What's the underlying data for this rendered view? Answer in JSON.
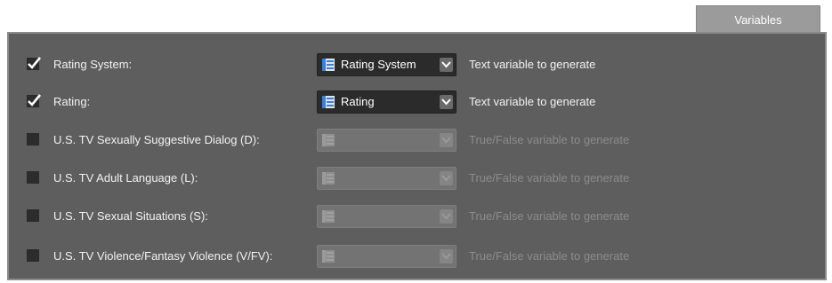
{
  "tab": {
    "label": "Variables"
  },
  "rows": [
    {
      "label": "Rating System:",
      "checked": true,
      "enabled": true,
      "value": "Rating System",
      "description": "Text variable to generate"
    },
    {
      "label": "Rating:",
      "checked": true,
      "enabled": true,
      "value": "Rating",
      "description": "Text variable to generate"
    },
    {
      "label": "U.S. TV Sexually Suggestive Dialog (D):",
      "checked": false,
      "enabled": false,
      "value": "",
      "description": "True/False variable to generate"
    },
    {
      "label": "U.S. TV Adult Language (L):",
      "checked": false,
      "enabled": false,
      "value": "",
      "description": "True/False variable to generate"
    },
    {
      "label": "U.S. TV Sexual Situations (S):",
      "checked": false,
      "enabled": false,
      "value": "",
      "description": "True/False variable to generate"
    },
    {
      "label": "U.S. TV Violence/Fantasy Violence (V/FV):",
      "checked": false,
      "enabled": false,
      "value": "",
      "description": "True/False variable to generate"
    }
  ],
  "icons": {
    "combo_icon": "list-icon",
    "dropdown_icon": "chevron-down-icon",
    "check_icon": "checkmark-icon"
  },
  "colors": {
    "panel_bg": "#5e5e5e",
    "tab_bg": "#9b9b9b",
    "combo_bg": "#2b2b2b",
    "disabled_text": "#8c8c8c",
    "icon_accent": "#3b7fd8"
  }
}
